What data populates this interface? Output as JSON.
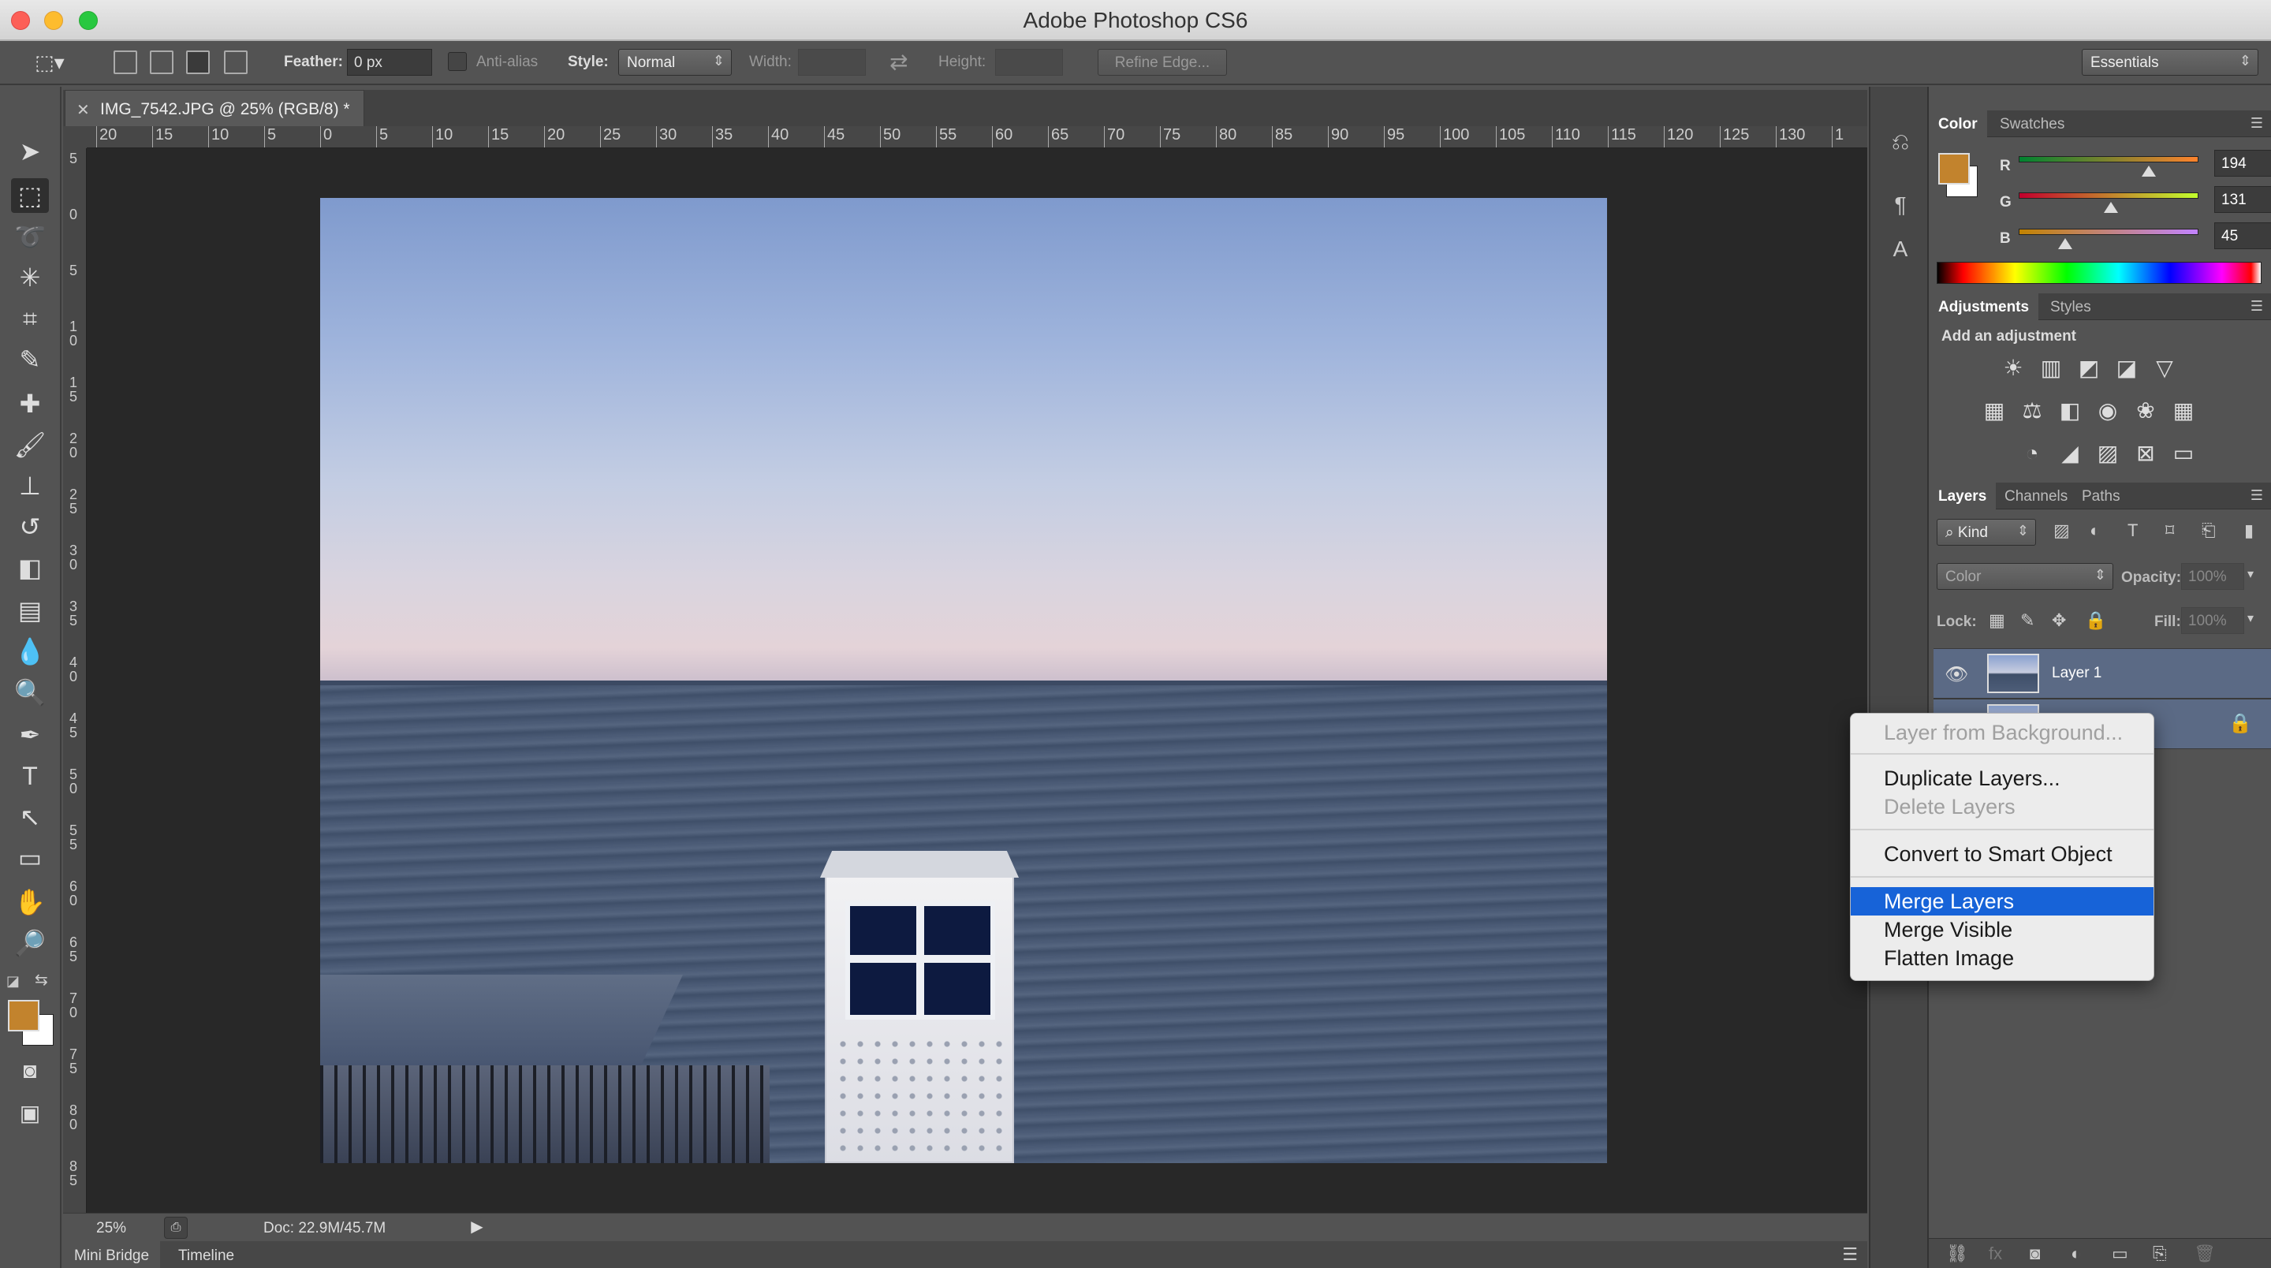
{
  "window": {
    "title": "Adobe Photoshop CS6"
  },
  "options_bar": {
    "feather_label": "Feather:",
    "feather_value": "0 px",
    "antialias_label": "Anti-alias",
    "style_label": "Style:",
    "style_value": "Normal",
    "width_label": "Width:",
    "height_label": "Height:",
    "refine_edge_label": "Refine Edge...",
    "workspace_value": "Essentials"
  },
  "document": {
    "tab_title": "IMG_7542.JPG @ 25% (RGB/8) *",
    "ruler_h": [
      "20",
      "15",
      "10",
      "5",
      "0",
      "5",
      "10",
      "15",
      "20",
      "25",
      "30",
      "35",
      "40",
      "45",
      "50",
      "55",
      "60",
      "65",
      "70",
      "75",
      "80",
      "85",
      "90",
      "95",
      "100",
      "105",
      "110",
      "115",
      "120",
      "125",
      "130",
      "1"
    ],
    "ruler_v": [
      "5",
      "0",
      "5",
      "1 0",
      "1 5",
      "2 0",
      "2 5",
      "3 0",
      "3 5",
      "4 0",
      "4 5",
      "5 0",
      "5 5",
      "6 0",
      "6 5",
      "7 0",
      "7 5",
      "8 0",
      "8 5"
    ]
  },
  "status_bar": {
    "zoom": "25%",
    "doc_size": "Doc: 22.9M/45.7M"
  },
  "bottom_tabs": [
    "Mini Bridge",
    "Timeline"
  ],
  "color_panel": {
    "tabs": [
      "Color",
      "Swatches"
    ],
    "foreground": "#c2832d",
    "background": "#ffffff",
    "r_label": "R",
    "r_value": "194",
    "g_label": "G",
    "g_value": "131",
    "b_label": "B",
    "b_value": "45"
  },
  "adjustments_panel": {
    "tabs": [
      "Adjustments",
      "Styles"
    ],
    "heading": "Add an adjustment"
  },
  "layers_panel": {
    "tabs": [
      "Layers",
      "Channels",
      "Paths"
    ],
    "filter_kind": "Kind",
    "blend_mode": "Color",
    "opacity_label": "Opacity:",
    "opacity_value": "100%",
    "lock_label": "Lock:",
    "fill_label": "Fill:",
    "fill_value": "100%",
    "layers": [
      {
        "name": "Layer 1"
      }
    ]
  },
  "context_menu": {
    "items": [
      {
        "label": "Layer from Background...",
        "state": "disabled"
      },
      {
        "label": "Duplicate Layers...",
        "state": "enabled"
      },
      {
        "label": "Delete Layers",
        "state": "disabled"
      },
      {
        "label": "Convert to Smart Object",
        "state": "enabled"
      },
      {
        "label": "Merge Layers",
        "state": "selected"
      },
      {
        "label": "Merge Visible",
        "state": "enabled"
      },
      {
        "label": "Flatten Image",
        "state": "enabled"
      }
    ]
  }
}
